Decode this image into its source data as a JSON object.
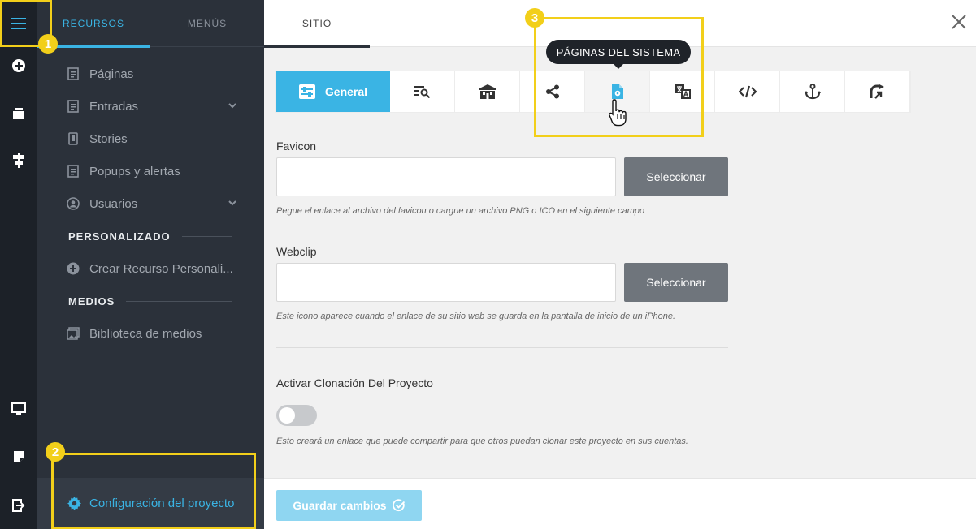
{
  "rail": {
    "items": [
      "menu-icon",
      "add-icon",
      "stack-icon",
      "pin-icon",
      "monitor-icon",
      "note-icon",
      "exit-icon"
    ]
  },
  "panel": {
    "tabs": [
      {
        "label": "RECURSOS",
        "active": true
      },
      {
        "label": "MENÚS",
        "active": false
      }
    ],
    "items": [
      {
        "label": "Páginas",
        "icon": "page-icon"
      },
      {
        "label": "Entradas",
        "icon": "page-icon",
        "expandable": true
      },
      {
        "label": "Stories",
        "icon": "phone-icon"
      },
      {
        "label": "Popups y alertas",
        "icon": "page-icon"
      },
      {
        "label": "Usuarios",
        "icon": "user-icon",
        "expandable": true
      }
    ],
    "section_custom": "PERSONALIZADO",
    "custom_item": "Crear Recurso Personali...",
    "section_media": "MEDIOS",
    "media_item": "Biblioteca de medios",
    "config_label": "Configuración del proyecto"
  },
  "header": {
    "site_tab": "SITIO"
  },
  "tabs": {
    "general_label": "General",
    "tooltip": "PÁGINAS DEL SISTEMA",
    "icons": [
      "search-list-icon",
      "building-icon",
      "share-icon",
      "file-gear-icon",
      "translate-icon",
      "code-icon",
      "anchor-icon",
      "redirect-icon"
    ]
  },
  "form": {
    "favicon_label": "Favicon",
    "favicon_value": "",
    "favicon_button": "Seleccionar",
    "favicon_help": "Pegue el enlace al archivo del favicon o cargue un archivo PNG o ICO en el siguiente campo",
    "webclip_label": "Webclip",
    "webclip_value": "",
    "webclip_button": "Seleccionar",
    "webclip_help": "Este icono aparece cuando el enlace de su sitio web se guarda en la pantalla de inicio de un iPhone.",
    "clone_label": "Activar Clonación Del Proyecto",
    "clone_enabled": false,
    "clone_help": "Esto creará un enlace que puede compartir para que otros puedan clonar este proyecto en sus cuentas."
  },
  "footer": {
    "save_label": "Guardar cambios"
  },
  "callouts": [
    "1",
    "2",
    "3"
  ],
  "colors": {
    "accent": "#3ab4e4",
    "highlight": "#f2cf1a",
    "rail": "#1c2128",
    "panel": "#2b313a"
  }
}
